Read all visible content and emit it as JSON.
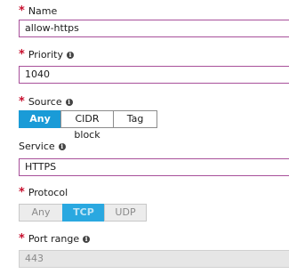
{
  "form": {
    "name": {
      "label": "Name",
      "required": true,
      "value": "allow-https"
    },
    "priority": {
      "label": "Priority",
      "required": true,
      "info_icon": "info-icon",
      "value": "1040"
    },
    "source": {
      "label": "Source",
      "required": true,
      "info_icon": "info-icon",
      "options": [
        "Any",
        "CIDR block",
        "Tag"
      ],
      "selected": "Any"
    },
    "service": {
      "label": "Service",
      "required": false,
      "info_icon": "info-icon",
      "value": "HTTPS"
    },
    "protocol": {
      "label": "Protocol",
      "required": true,
      "options": [
        "Any",
        "TCP",
        "UDP"
      ],
      "selected": "TCP",
      "disabled": true
    },
    "port_range": {
      "label": "Port range",
      "required": true,
      "info_icon": "info-icon",
      "value": "443",
      "disabled": true
    }
  },
  "colors": {
    "required_asterisk": "#c8102e",
    "active_border": "#a8509a",
    "selected_segment": "#1a9bd7",
    "disabled_background": "#e6e6e6"
  }
}
